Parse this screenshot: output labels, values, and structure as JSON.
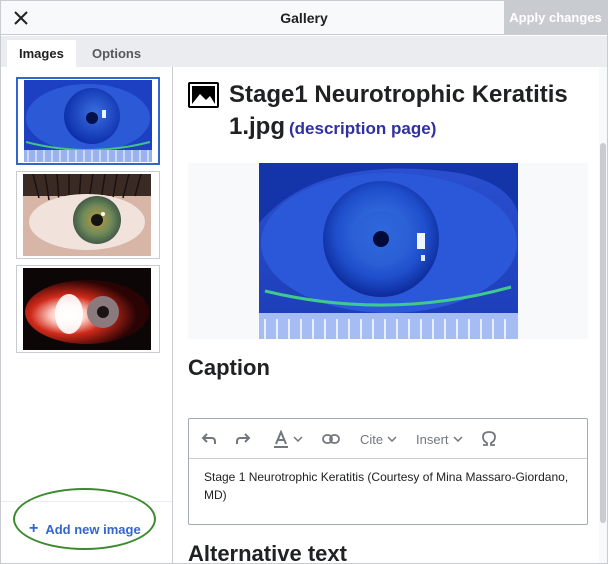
{
  "header": {
    "title": "Gallery",
    "apply_label": "Apply changes",
    "close_icon": "close-icon"
  },
  "tabs": [
    {
      "label": "Images",
      "active": true
    },
    {
      "label": "Options",
      "active": false
    }
  ],
  "sidebar": {
    "thumbnails": [
      {
        "name": "thumbnail-blue-eye",
        "selected": true
      },
      {
        "name": "thumbnail-hazel-eye",
        "selected": false
      },
      {
        "name": "thumbnail-red-eye",
        "selected": false
      }
    ],
    "add_label": "Add new image"
  },
  "main": {
    "image_title_line1": "Stage1 Neurotrophic Keratitis",
    "image_title_line2": "1.jpg",
    "description_link": "(description page)",
    "caption_heading": "Caption",
    "alt_heading": "Alternative text",
    "caption_text": "Stage 1 Neurotrophic Keratitis (Courtesy of Mina Massaro-Giordano, MD)",
    "toolbar": {
      "cite_label": "Cite",
      "insert_label": "Insert"
    }
  },
  "colors": {
    "accent": "#3366cc",
    "highlight": "#3b8a2e",
    "link": "#3030a0"
  }
}
